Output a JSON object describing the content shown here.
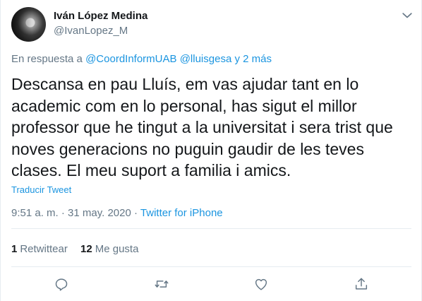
{
  "author": {
    "name": "Iván López Medina",
    "handle": "@IvanLopez_M"
  },
  "reply_context": {
    "prefix": "En respuesta a",
    "mention1": "@CoordInformUAB",
    "mention2": "@lluisgesa",
    "suffix": "y 2 más"
  },
  "tweet": {
    "text": "Descansa en pau Lluís, em vas ajudar tant en lo academic com en lo personal, has sigut el millor professor que he tingut a la universitat i sera trist que noves generacions no puguin gaudir de les teves clases. El meu suport a familia i amics.",
    "translate_label": "Traducir Tweet"
  },
  "meta": {
    "time": "9:51 a. m.",
    "separator": "·",
    "date": "31 may. 2020",
    "source": "Twitter for iPhone"
  },
  "stats": {
    "retweets_count": "1",
    "retweets_label": "Retwittear",
    "likes_count": "12",
    "likes_label": "Me gusta"
  },
  "actions": [
    "reply-icon",
    "retweet-icon",
    "like-icon",
    "share-icon"
  ],
  "colors": {
    "link": "#1b95e0",
    "secondary_text": "#657786",
    "primary_text": "#14171a",
    "divider": "#e6ecf0"
  }
}
